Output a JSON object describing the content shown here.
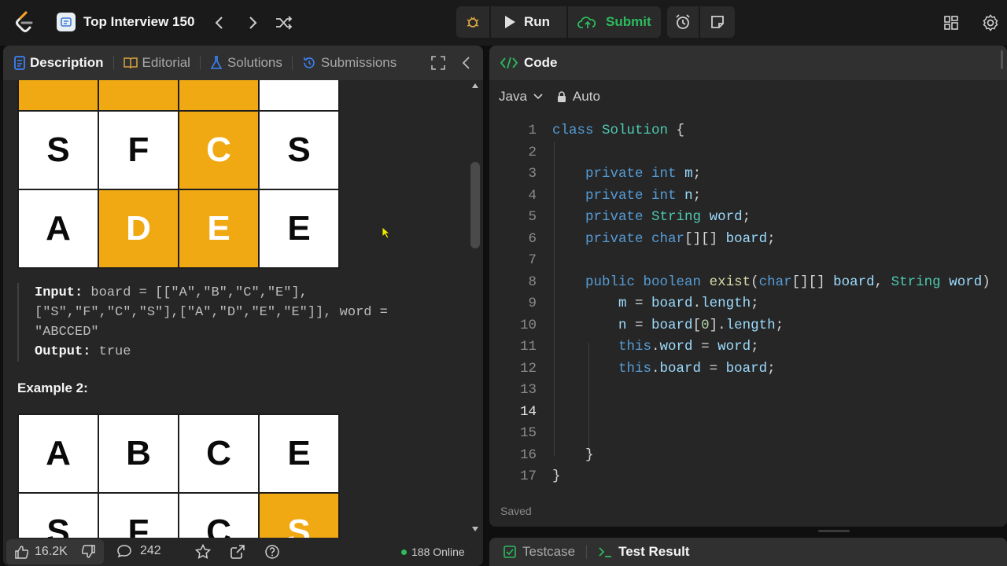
{
  "header": {
    "problem_list_title": "Top Interview 150",
    "run_label": "Run",
    "submit_label": "Submit"
  },
  "left_tabs": [
    {
      "label": "Description"
    },
    {
      "label": "Editorial"
    },
    {
      "label": "Solutions"
    },
    {
      "label": "Submissions"
    }
  ],
  "grid_top_rows": [
    [
      "",
      "",
      "",
      ""
    ],
    [
      "S",
      "F",
      "C",
      "S"
    ],
    [
      "A",
      "D",
      "E",
      "E"
    ]
  ],
  "example1": {
    "input_label": "Input:",
    "input_line1": " board = [[\"A\",\"B\",\"C\",\"E\"],",
    "input_line2": "[\"S\",\"F\",\"C\",\"S\"],[\"A\",\"D\",\"E\",\"E\"]], word =",
    "input_line3": "\"ABCCED\"",
    "output_label": "Output:",
    "output_value": " true"
  },
  "example2_title": "Example 2:",
  "grid_bottom_rows": [
    [
      "A",
      "B",
      "C",
      "E"
    ],
    [
      "S",
      "F",
      "C",
      "S"
    ]
  ],
  "footer": {
    "likes": "16.2K",
    "comments": "242",
    "online": "188 Online"
  },
  "code_panel": {
    "title": "Code",
    "language": "Java",
    "mode": "Auto",
    "status": "Saved"
  },
  "code_lines": [
    "1",
    "2",
    "3",
    "4",
    "5",
    "6",
    "7",
    "8",
    "9",
    "10",
    "11",
    "12",
    "13",
    "14",
    "15",
    "16",
    "17"
  ],
  "bottom_tabs": {
    "testcase": "Testcase",
    "test_result": "Test Result"
  }
}
